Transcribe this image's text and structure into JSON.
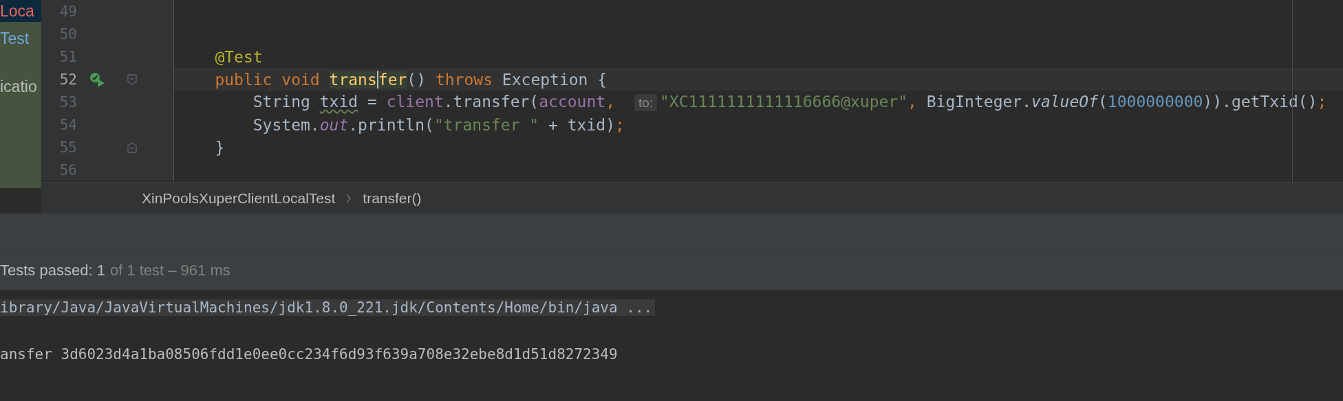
{
  "sidebar": {
    "items": [
      {
        "label": "Loca",
        "kind": "error",
        "selected": true
      },
      {
        "label": "Test",
        "kind": "test",
        "selected": false
      },
      {
        "label": "icatio",
        "kind": "plain",
        "selected": false
      }
    ]
  },
  "editor": {
    "lines": [
      {
        "number": "49",
        "current": false
      },
      {
        "number": "50",
        "current": false
      },
      {
        "number": "51",
        "current": false,
        "tokens": [
          {
            "text": "    @Test",
            "kind": "annotation"
          }
        ]
      },
      {
        "number": "52",
        "current": true,
        "run_marker": true,
        "fold_start": true,
        "tokens": [
          {
            "text": "    public void ",
            "kind": "keyword"
          },
          {
            "text": "trans",
            "kind": "declaration",
            "caret_after": true
          },
          {
            "text": "fer",
            "kind": "declaration"
          },
          {
            "text": "() ",
            "kind": "plain"
          },
          {
            "text": "throws ",
            "kind": "keyword"
          },
          {
            "text": "Exception {",
            "kind": "plain"
          }
        ]
      },
      {
        "number": "53",
        "current": false,
        "tokens": [
          {
            "text": "        String ",
            "kind": "plain"
          },
          {
            "text": "txid",
            "kind": "plain",
            "warning": true
          },
          {
            "text": " = ",
            "kind": "plain"
          },
          {
            "text": "client",
            "kind": "field"
          },
          {
            "text": ".transfer(",
            "kind": "plain"
          },
          {
            "text": "account",
            "kind": "field"
          },
          {
            "text": ", ",
            "kind": "keyword"
          },
          {
            "text": "to:",
            "kind": "hint"
          },
          {
            "text": "\"XC1111111111116666@xuper\"",
            "kind": "string"
          },
          {
            "text": ", ",
            "kind": "keyword"
          },
          {
            "text": "BigInteger.",
            "kind": "plain"
          },
          {
            "text": "valueOf",
            "kind": "static"
          },
          {
            "text": "(",
            "kind": "plain"
          },
          {
            "text": "1000000000",
            "kind": "number"
          },
          {
            "text": ")).getTxid()",
            "kind": "plain"
          },
          {
            "text": ";",
            "kind": "keyword"
          }
        ]
      },
      {
        "number": "54",
        "current": false,
        "tokens": [
          {
            "text": "        System.",
            "kind": "plain"
          },
          {
            "text": "out",
            "kind": "static-field"
          },
          {
            "text": ".println(",
            "kind": "plain"
          },
          {
            "text": "\"transfer \"",
            "kind": "string"
          },
          {
            "text": " + txid)",
            "kind": "plain"
          },
          {
            "text": ";",
            "kind": "keyword"
          }
        ]
      },
      {
        "number": "55",
        "current": false,
        "fold_end": true,
        "tokens": [
          {
            "text": "    }",
            "kind": "plain"
          }
        ]
      },
      {
        "number": "56",
        "current": false
      }
    ]
  },
  "breadcrumbs": [
    "XinPoolsXuperClientLocalTest",
    "transfer()"
  ],
  "test_status": {
    "label": "Tests passed: 1",
    "detail": "of 1 test – 961 ms"
  },
  "console": {
    "lines": [
      {
        "text": "ibrary/Java/JavaVirtualMachines/jdk1.8.0_221.jdk/Contents/Home/bin/java ...",
        "kind": "command"
      },
      {
        "text": "ansfer 3d6023d4a1ba08506fdd1e0ee0cc234f6d93f639a708e32ebe8d1d51d8272349",
        "kind": "output"
      }
    ]
  }
}
